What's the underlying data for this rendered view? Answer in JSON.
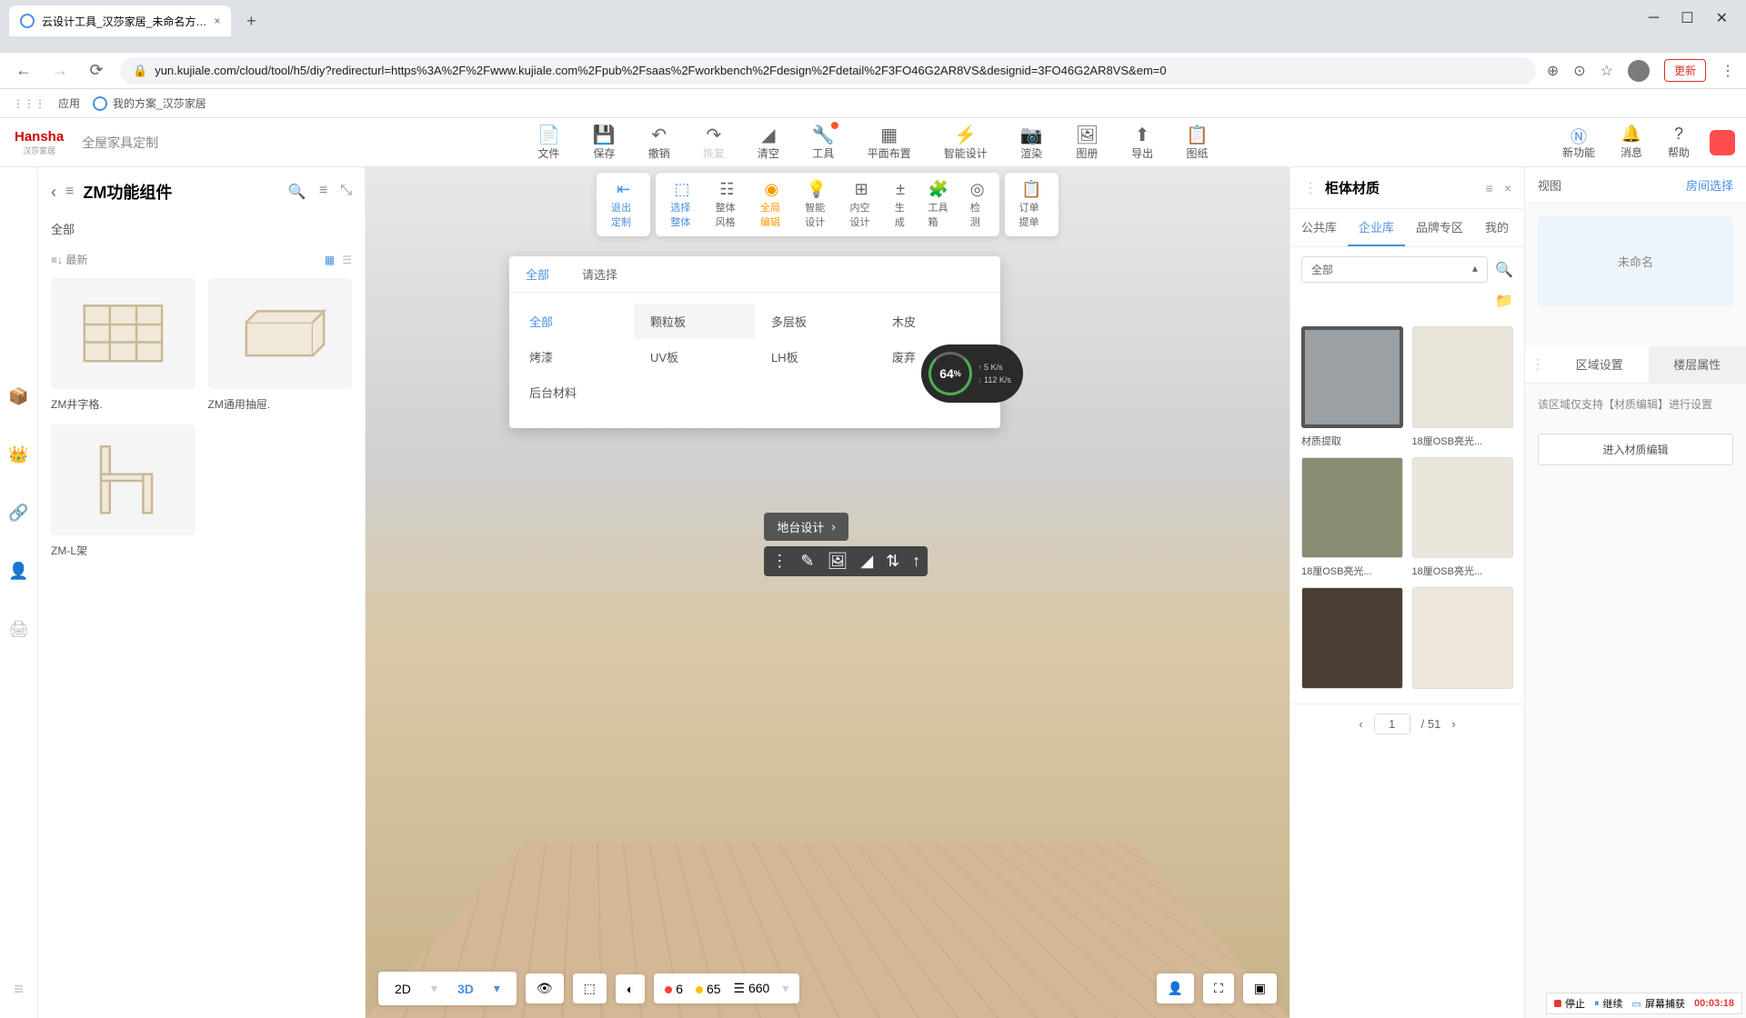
{
  "browser": {
    "tab_title": "云设计工具_汉莎家居_未命名方…",
    "url": "yun.kujiale.com/cloud/tool/h5/diy?redirecturl=https%3A%2F%2Fwww.kujiale.com%2Fpub%2Fsaas%2Fworkbench%2Fdesign%2Fdetail%2F3FO46G2AR8VS&designid=3FO46G2AR8VS&em=0",
    "update": "更新",
    "apps": "应用",
    "bookmark": "我的方案_汉莎家居"
  },
  "header": {
    "logo": "Hansha",
    "logo_sub": "汉莎家居",
    "title": "全屋家具定制",
    "tools": {
      "file": "文件",
      "save": "保存",
      "undo": "撤销",
      "redo": "恢复",
      "clear": "清空",
      "tool": "工具",
      "layout": "平面布置",
      "smart": "智能设计",
      "render": "渲染",
      "album": "图册",
      "export": "导出",
      "drawing": "图纸"
    },
    "right": {
      "new": "新功能",
      "msg": "消息",
      "help": "帮助"
    }
  },
  "subtoolbar": {
    "exit": "退出定制",
    "select": "选择整体",
    "whole": "整体风格",
    "global": "全局编辑",
    "smart": "智能设计",
    "content": "内空设计",
    "gen": "生成",
    "toolbox": "工具箱",
    "check": "检测",
    "order": "订单提单"
  },
  "left": {
    "title": "ZM功能组件",
    "filter": "全部",
    "sort": "最新",
    "items": [
      "ZM井字格.",
      "ZM通用抽屉.",
      "ZM-L架"
    ]
  },
  "context": {
    "label": "地台设计"
  },
  "dropdown": {
    "tabs": {
      "all": "全部",
      "please": "请选择"
    },
    "items": [
      "全部",
      "颗粒板",
      "多层板",
      "木皮",
      "烤漆",
      "UV板",
      "LH板",
      "废弃",
      "后台材料"
    ]
  },
  "perf": {
    "pct": "64",
    "pct_unit": "%",
    "up": "5",
    "down": "112",
    "unit": "K/s"
  },
  "viewport": {
    "d2": "2D",
    "d3": "3D",
    "stat1": "6",
    "stat2": "65",
    "stat3": "660"
  },
  "right": {
    "title": "柜体材质",
    "tabs": {
      "pub": "公共库",
      "ent": "企业库",
      "brand": "品牌专区",
      "my": "我的"
    },
    "select": "全部",
    "items": [
      {
        "label": "材质提取",
        "color": "#9aa0a3"
      },
      {
        "label": "18厘OSB亮光...",
        "color": "#e8e4da"
      },
      {
        "label": "18厘OSB亮光...",
        "color": "#8a8c72"
      },
      {
        "label": "18厘OSB亮光...",
        "color": "#eae6dc"
      },
      {
        "label": "",
        "color": "#4a3f32"
      },
      {
        "label": "",
        "color": "#ece7d9"
      }
    ],
    "page": "1",
    "total": "/ 51"
  },
  "farright": {
    "view": "视图",
    "room": "房间选择",
    "unnamed": "未命名",
    "tabs": {
      "region": "区域设置",
      "floor": "楼层属性"
    },
    "hint": "该区域仅支持【材质编辑】进行设置",
    "btn": "进入材质编辑"
  },
  "rec": {
    "stop": "停止",
    "cont": "继续",
    "cap": "屏幕捕获",
    "time": "00:03:18"
  }
}
